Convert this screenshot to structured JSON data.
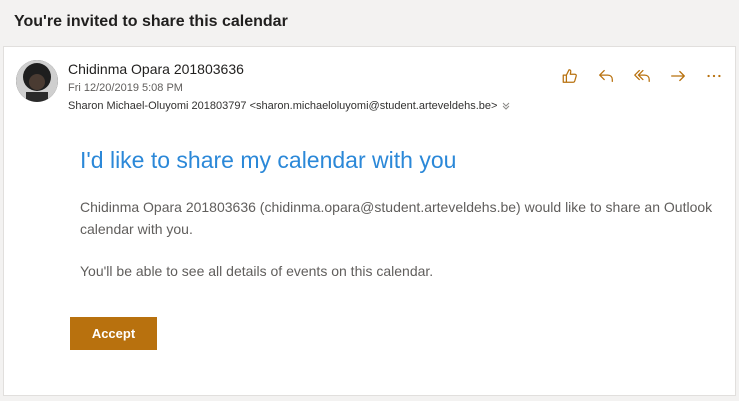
{
  "header": {
    "title": "You're invited to share this calendar"
  },
  "message": {
    "sender": "Chidinma Opara 201803636",
    "date": "Fri 12/20/2019 5:08 PM",
    "recipients": "Sharon Michael-Oluyomi 201803797 <sharon.michaeloluyomi@student.arteveldehs.be>"
  },
  "actions": [
    "like-icon",
    "reply-icon",
    "reply-all-icon",
    "forward-icon",
    "more-icon"
  ],
  "body": {
    "title": "I'd like to share my calendar with you",
    "paragraph1": "Chidinma Opara 201803636 (chidinma.opara@student.arteveldehs.be) would like to share an Outlook calendar with you.",
    "paragraph2": "You'll be able to see all details of events on this calendar.",
    "accept_label": "Accept"
  },
  "colors": {
    "accent": "#b8710e",
    "title_blue": "#2b88d8"
  }
}
